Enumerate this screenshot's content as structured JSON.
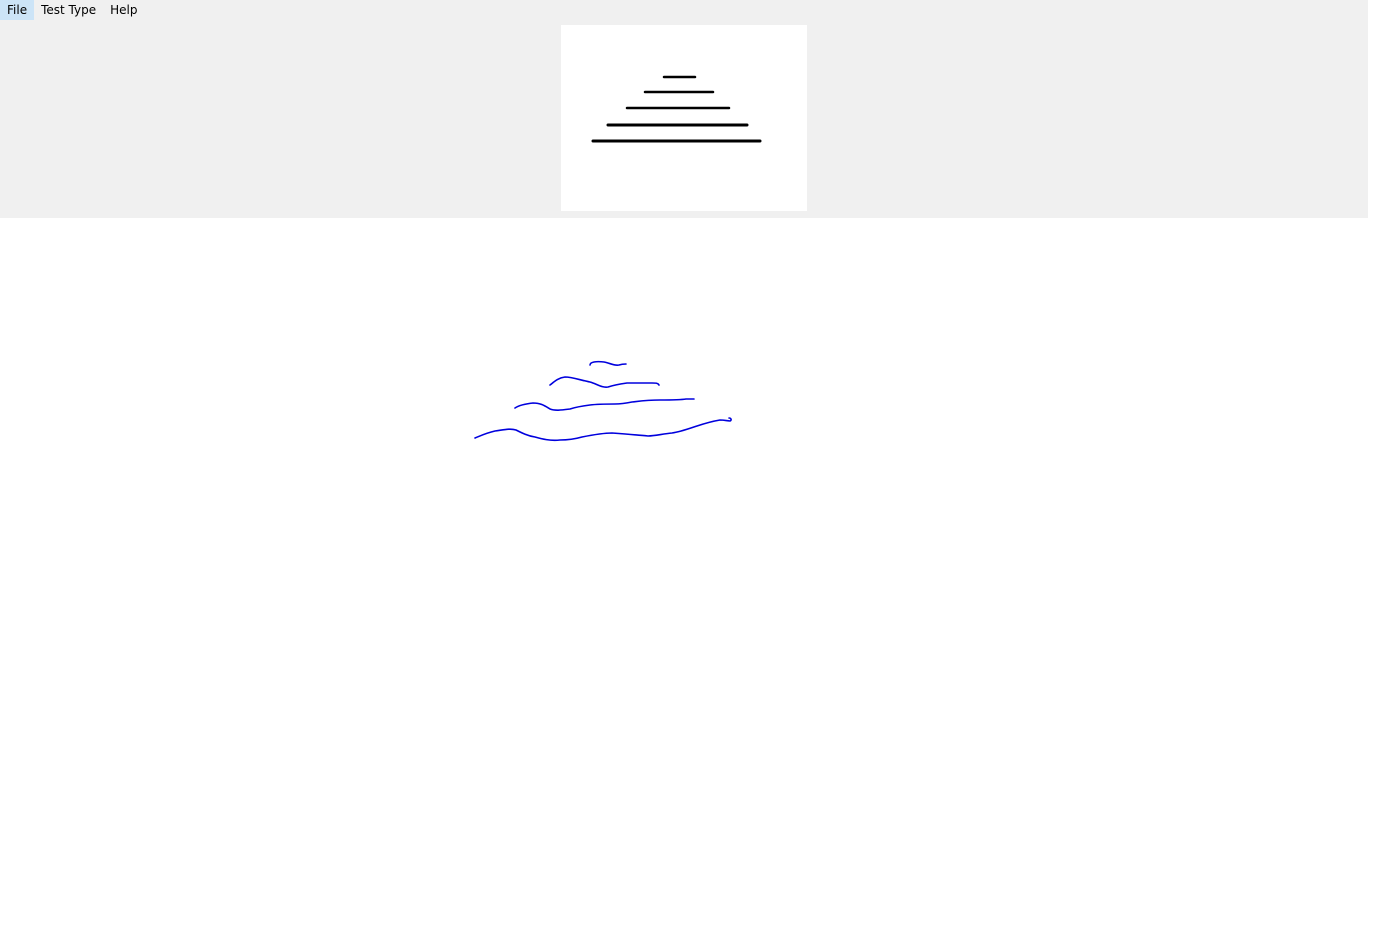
{
  "menubar": {
    "items": [
      {
        "label": "File"
      },
      {
        "label": "Test Type"
      },
      {
        "label": "Help"
      }
    ]
  },
  "reference_figure": {
    "description_icon": "stacked-horizontal-lines-pyramid",
    "line_color": "#000000",
    "line_count": 5
  },
  "drawing": {
    "stroke_color": "#0000dd",
    "stroke_count": 4
  },
  "colors": {
    "panel_background": "#f0f0f0",
    "canvas_background": "#ffffff"
  }
}
